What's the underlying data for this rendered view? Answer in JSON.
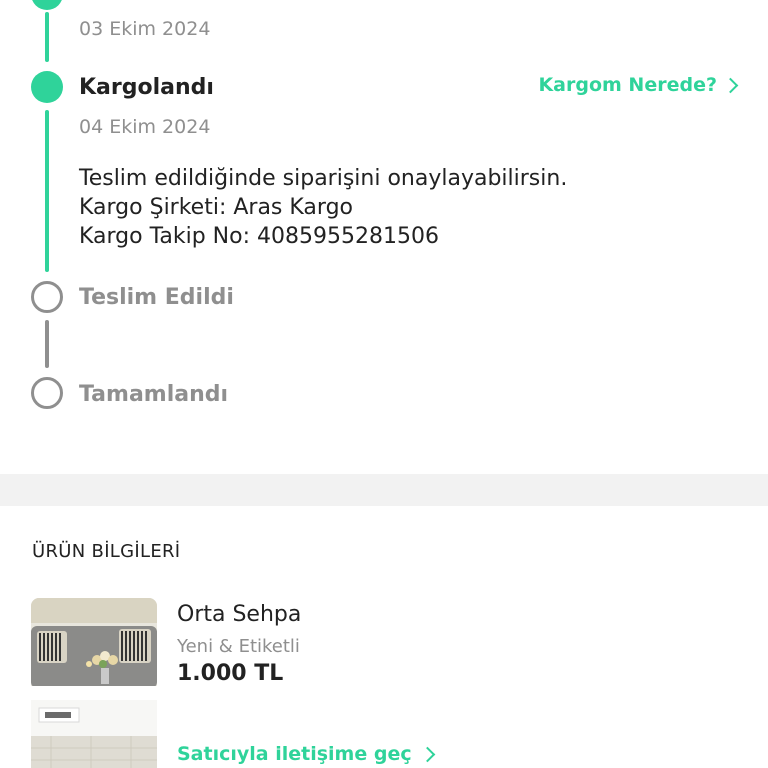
{
  "timeline": {
    "previous_step_date": "03 Ekim 2024",
    "steps": [
      {
        "title": "Kargolandı",
        "date": "04 Ekim 2024",
        "state": "done"
      },
      {
        "title": "Teslim Edildi",
        "state": "pending"
      },
      {
        "title": "Tamamlandı",
        "state": "pending"
      }
    ],
    "where_link_label": "Kargom Nerede?",
    "details": {
      "line1": "Teslim edildiğinde siparişini onaylayabilirsin.",
      "line2": "Kargo Şirketi: Aras Kargo",
      "line3": "Kargo Takip No: 4085955281506"
    }
  },
  "product_section": {
    "title": "ÜRÜN BİLGİLERİ",
    "product": {
      "name": "Orta Sehpa",
      "condition": "Yeni & Etiketli",
      "price": "1.000 TL"
    },
    "contact_label": "Satıcıyla iletişime geç"
  },
  "colors": {
    "accent": "#2fd39a",
    "inactive": "#8f8f8f",
    "text": "#222222",
    "divider": "#f2f2f2"
  }
}
